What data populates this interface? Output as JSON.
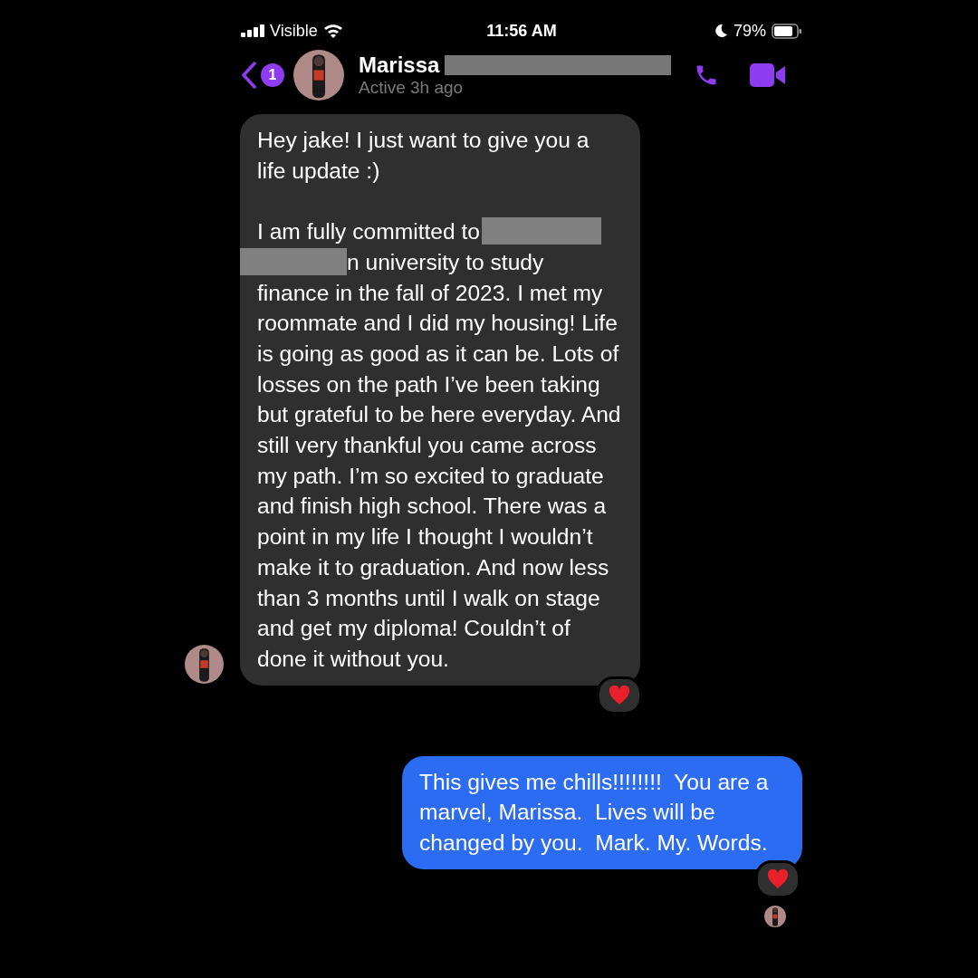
{
  "status_bar": {
    "carrier": "Visible",
    "time": "11:56 AM",
    "battery": "79%"
  },
  "header": {
    "back_badge": "1",
    "name": "Marissa",
    "status": "Active 3h ago",
    "name_redacted": true
  },
  "messages": [
    {
      "kind": "incoming",
      "reacted": true,
      "parts": [
        {
          "kind": "text",
          "text": "Hey jake! I just want to give you a life update :)"
        },
        {
          "kind": "break"
        },
        {
          "kind": "text",
          "text": "I am fully committed to"
        },
        {
          "kind": "redaction"
        },
        {
          "kind": "newline"
        },
        {
          "kind": "redaction"
        },
        {
          "kind": "text",
          "text": "n university to study"
        },
        {
          "kind": "newline"
        },
        {
          "kind": "text",
          "text": "finance in the fall of 2023. I met my roommate and I did my housing! Life is going as good as it can be. Lots of losses on the path I’ve been taking but grateful to be here everyday. And still very thankful you came across my path. I’m so excited to graduate and finish high school. There was a point in my life I thought I wouldn’t make it to graduation. And now less than 3 months until I walk on stage and get my diploma! Couldn’t of done it without you."
        }
      ]
    },
    {
      "kind": "outgoing",
      "reacted": true,
      "seen": true,
      "parts": [
        {
          "kind": "text",
          "text": "This gives me chills!!!!!!!!  You are a marvel, Marissa.  Lives will be changed by you.  Mark. My. Words."
        }
      ]
    }
  ]
}
